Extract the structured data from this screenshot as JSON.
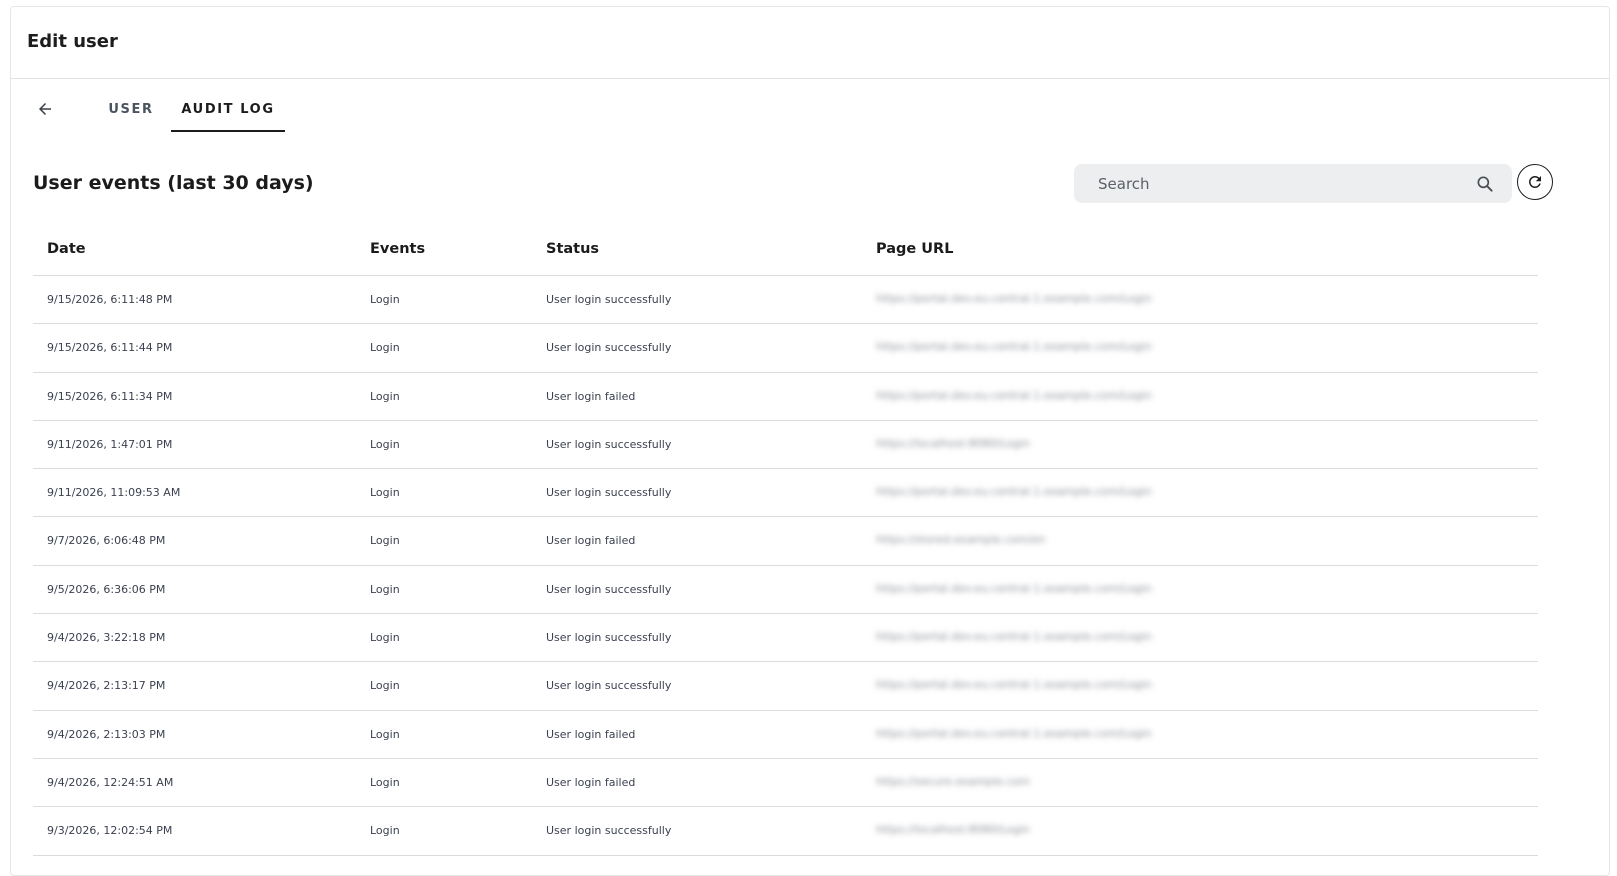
{
  "header": {
    "title": "Edit user"
  },
  "tabs": {
    "user_label": "USER",
    "audit_label": "AUDIT LOG"
  },
  "section": {
    "title": "User events (last 30 days)"
  },
  "search": {
    "placeholder": "Search",
    "value": ""
  },
  "table": {
    "columns": [
      "Date",
      "Events",
      "Status",
      "Page URL"
    ],
    "rows": [
      {
        "date": "9/15/2026, 6:11:48 PM",
        "event": "Login",
        "status": "User login successfully",
        "url": "https://portal.dev.eu.central.1.example.com/Login"
      },
      {
        "date": "9/15/2026, 6:11:44 PM",
        "event": "Login",
        "status": "User login successfully",
        "url": "https://portal.dev.eu.central.1.example.com/Login"
      },
      {
        "date": "9/15/2026, 6:11:34 PM",
        "event": "Login",
        "status": "User login failed",
        "url": "https://portal.dev.eu.central.1.example.com/Login"
      },
      {
        "date": "9/11/2026, 1:47:01 PM",
        "event": "Login",
        "status": "User login successfully",
        "url": "https://localhost:8080/Login"
      },
      {
        "date": "9/11/2026, 11:09:53 AM",
        "event": "Login",
        "status": "User login successfully",
        "url": "https://portal.dev.eu.central.1.example.com/Login"
      },
      {
        "date": "9/7/2026, 6:06:48 PM",
        "event": "Login",
        "status": "User login failed",
        "url": "https://stored.example.com/en"
      },
      {
        "date": "9/5/2026, 6:36:06 PM",
        "event": "Login",
        "status": "User login successfully",
        "url": "https://portal.dev.eu.central.1.example.com/Login"
      },
      {
        "date": "9/4/2026, 3:22:18 PM",
        "event": "Login",
        "status": "User login successfully",
        "url": "https://portal.dev.eu.central.1.example.com/Login"
      },
      {
        "date": "9/4/2026, 2:13:17 PM",
        "event": "Login",
        "status": "User login successfully",
        "url": "https://portal.dev.eu.central.1.example.com/Login"
      },
      {
        "date": "9/4/2026, 2:13:03 PM",
        "event": "Login",
        "status": "User login failed",
        "url": "https://portal.dev.eu.central.1.example.com/Login"
      },
      {
        "date": "9/4/2026, 12:24:51 AM",
        "event": "Login",
        "status": "User login failed",
        "url": "https://secure.example.com"
      },
      {
        "date": "9/3/2026, 12:02:54 PM",
        "event": "Login",
        "status": "User login successfully",
        "url": "https://localhost:8080/Login"
      }
    ]
  },
  "icons": {
    "back": "arrow-left-icon",
    "search": "search-icon",
    "refresh": "refresh-icon"
  }
}
